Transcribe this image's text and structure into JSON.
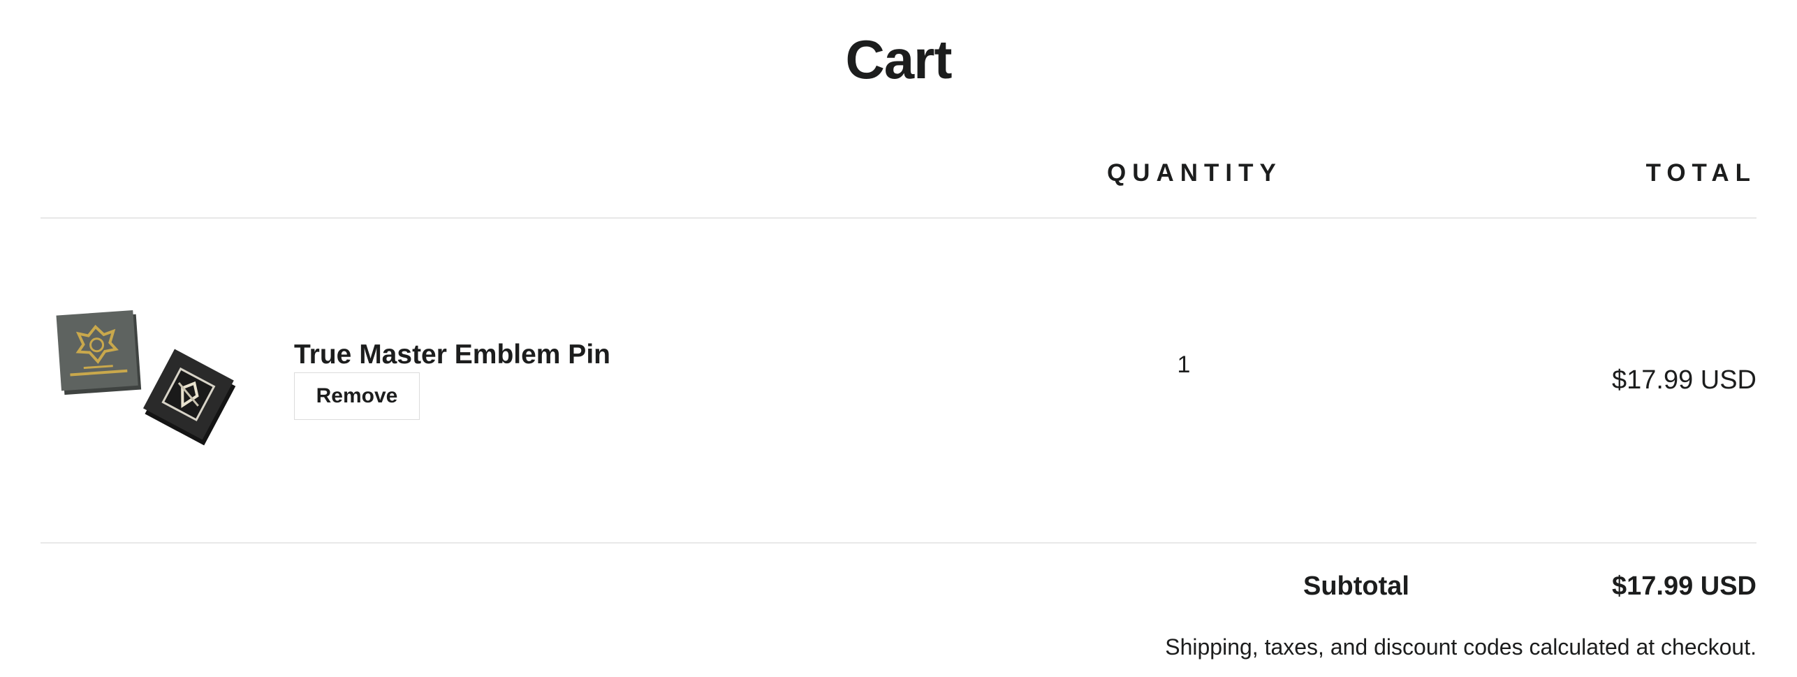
{
  "page": {
    "title": "Cart"
  },
  "table": {
    "quantity_header": "QUANTITY",
    "total_header": "TOTAL"
  },
  "items": [
    {
      "name": "True Master Emblem Pin",
      "remove_label": "Remove",
      "quantity": "1",
      "total": "$17.99 USD",
      "image_icon": "product-image"
    }
  ],
  "summary": {
    "subtotal_label": "Subtotal",
    "subtotal_value": "$17.99 USD",
    "note": "Shipping, taxes, and discount codes calculated at checkout."
  },
  "colors": {
    "text": "#1c1d1d",
    "divider": "#e8e8e8",
    "box_grey": "#5a5f5c",
    "box_dark": "#262626",
    "gold": "#c9a84c"
  }
}
